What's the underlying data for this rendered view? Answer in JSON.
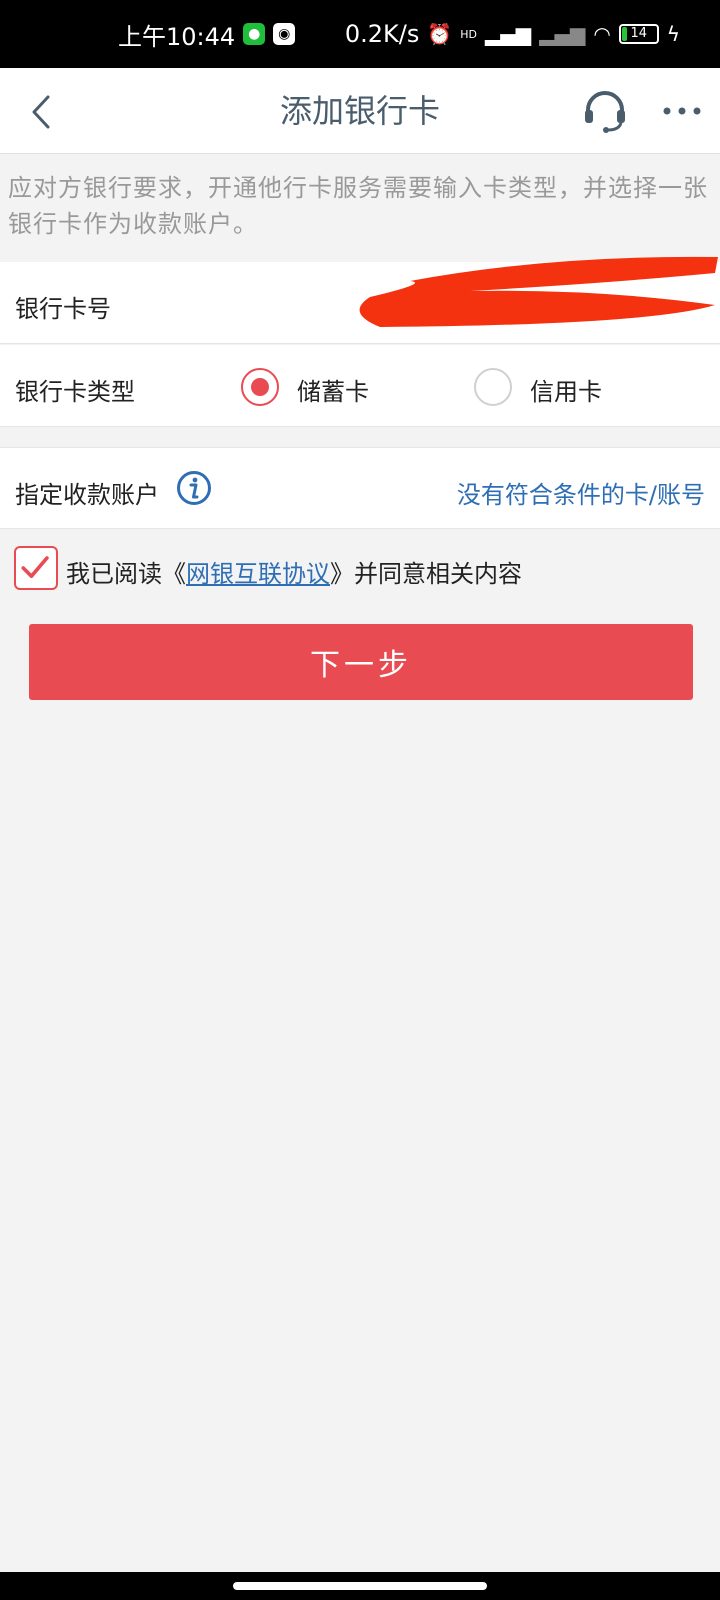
{
  "status_bar": {
    "time": "上午10:44",
    "net_speed": "0.2K/s",
    "network_label": "HD",
    "battery_level": "14"
  },
  "header": {
    "title": "添加银行卡"
  },
  "notice": {
    "text": "应对方银行要求，开通他行卡服务需要输入卡类型，并选择一张银行卡作为收款账户。"
  },
  "form": {
    "card_number_label": "银行卡号",
    "card_number_visible": "",
    "card_type_label": "银行卡类型",
    "card_type_options": [
      "储蓄卡",
      "信用卡"
    ],
    "card_type_selected": "储蓄卡",
    "receiving_account_label": "指定收款账户",
    "receiving_account_value": "没有符合条件的卡/账号"
  },
  "agreement": {
    "checked": true,
    "prefix": "我已阅读",
    "open_quote": "《",
    "link_text": "网银互联协议",
    "close_quote": "》",
    "suffix": "并同意相关内容"
  },
  "actions": {
    "next_label": "下一步"
  },
  "colors": {
    "accent_red": "#e84b52",
    "link_blue": "#2e6eb5",
    "title_gray": "#4a5d6d",
    "redaction_red": "#f4320f"
  },
  "icons": {
    "back": "chevron-left-icon",
    "support": "headset-icon",
    "more": "more-dots-icon",
    "info": "info-icon",
    "check": "checkmark-icon"
  }
}
